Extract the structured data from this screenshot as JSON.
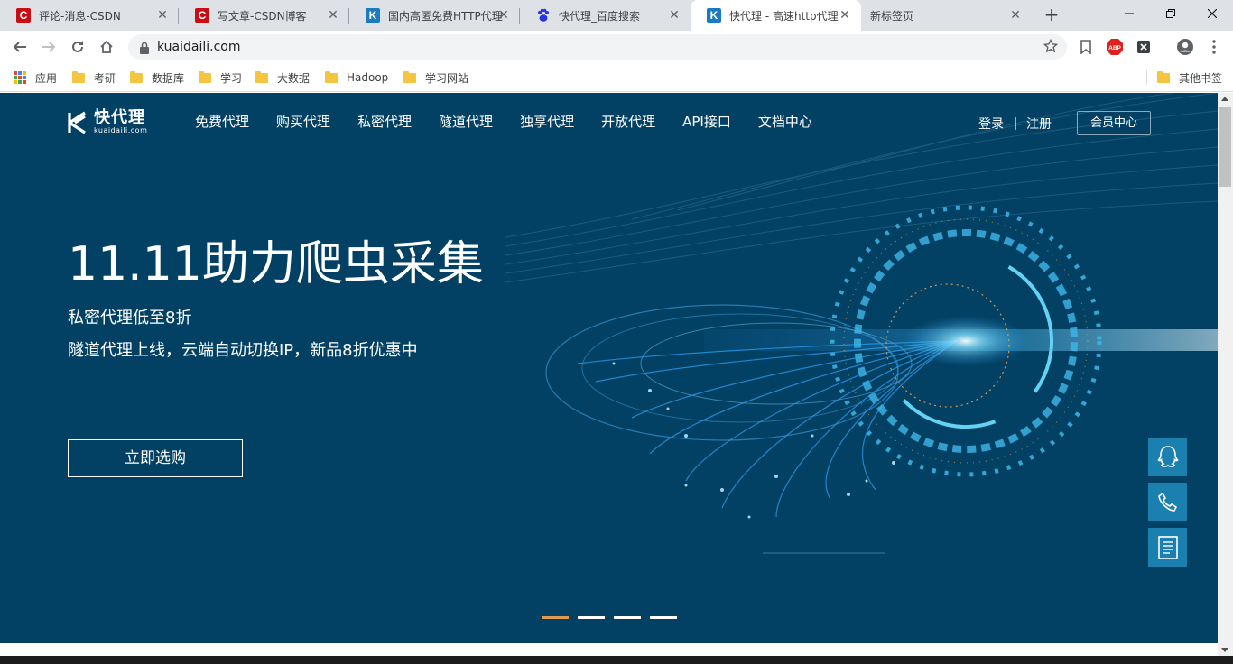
{
  "browser": {
    "tabs": [
      {
        "title": "评论-消息-CSDN",
        "favicon": "csdn-icon"
      },
      {
        "title": "写文章-CSDN博客",
        "favicon": "csdn-icon"
      },
      {
        "title": "国内高匿免费HTTP代理",
        "favicon": "kuaidaili-icon"
      },
      {
        "title": "快代理_百度搜索",
        "favicon": "baidu-paw-icon"
      },
      {
        "title": "快代理 - 高速http代理",
        "favicon": "kuaidaili-icon",
        "active": true
      },
      {
        "title": "新标签页",
        "favicon": ""
      }
    ],
    "new_tab_label": "+",
    "url": "kuaidaili.com",
    "bookmarks": {
      "apps": "应用",
      "items": [
        "考研",
        "数据库",
        "学习",
        "大数据",
        "Hadoop",
        "学习网站"
      ],
      "other": "其他书签"
    },
    "extensions": [
      "bookmark-icon",
      "adblock-icon",
      "x-extension-icon",
      "profile-icon",
      "menu-icon"
    ]
  },
  "site": {
    "logo": {
      "name": "快代理",
      "domain": "kuaidaili.com"
    },
    "nav": [
      "免费代理",
      "购买代理",
      "私密代理",
      "隧道代理",
      "独享代理",
      "开放代理",
      "API接口",
      "文档中心"
    ],
    "login": "登录",
    "register": "注册",
    "member_center": "会员中心",
    "hero": {
      "title": "11.11助力爬虫采集",
      "line1": "私密代理低至8折",
      "line2": "隧道代理上线，云端自动切换IP，新品8折优惠中",
      "cta": "立即选购"
    },
    "carousel": {
      "count": 4,
      "active": 0
    },
    "floating": [
      "qq-icon",
      "phone-icon",
      "document-icon"
    ]
  },
  "colors": {
    "hero_bg": "#034164",
    "accent_orange": "#e39a4e",
    "float_blue": "#1b7fb0"
  }
}
